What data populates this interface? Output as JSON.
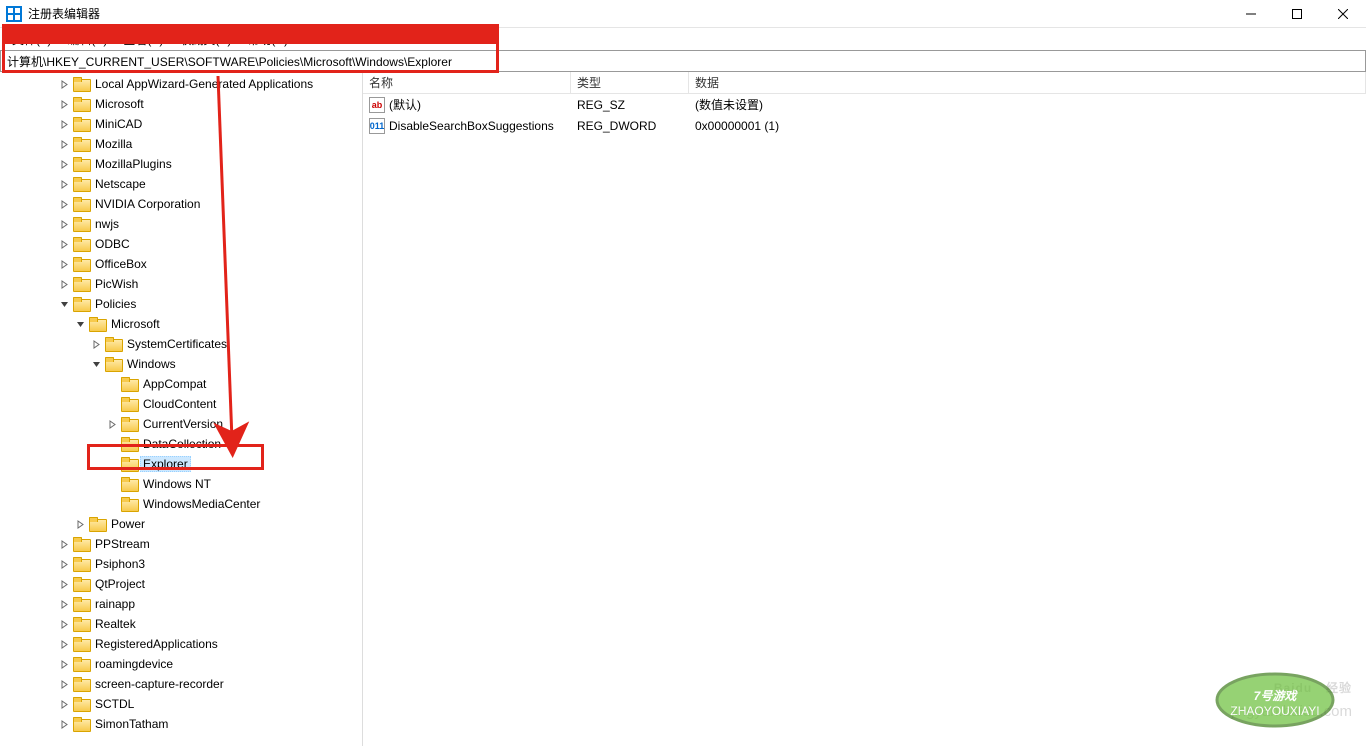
{
  "window": {
    "title": "注册表编辑器"
  },
  "menu": {
    "file": "文件(F)",
    "edit": "编辑(E)",
    "view": "查看(V)",
    "favorites": "收藏夹(A)",
    "help": "帮助(H)"
  },
  "address": {
    "path": "计算机\\HKEY_CURRENT_USER\\SOFTWARE\\Policies\\Microsoft\\Windows\\Explorer"
  },
  "tree": {
    "nodes": [
      {
        "indent": 3,
        "exp": ">",
        "label": "Local AppWizard-Generated Applications"
      },
      {
        "indent": 3,
        "exp": ">",
        "label": "Microsoft"
      },
      {
        "indent": 3,
        "exp": ">",
        "label": "MiniCAD"
      },
      {
        "indent": 3,
        "exp": ">",
        "label": "Mozilla"
      },
      {
        "indent": 3,
        "exp": ">",
        "label": "MozillaPlugins"
      },
      {
        "indent": 3,
        "exp": ">",
        "label": "Netscape"
      },
      {
        "indent": 3,
        "exp": ">",
        "label": "NVIDIA Corporation"
      },
      {
        "indent": 3,
        "exp": ">",
        "label": "nwjs"
      },
      {
        "indent": 3,
        "exp": ">",
        "label": "ODBC"
      },
      {
        "indent": 3,
        "exp": ">",
        "label": "OfficeBox"
      },
      {
        "indent": 3,
        "exp": ">",
        "label": "PicWish"
      },
      {
        "indent": 3,
        "exp": "v",
        "label": "Policies"
      },
      {
        "indent": 4,
        "exp": "v",
        "label": "Microsoft"
      },
      {
        "indent": 5,
        "exp": ">",
        "label": "SystemCertificates"
      },
      {
        "indent": 5,
        "exp": "v",
        "label": "Windows"
      },
      {
        "indent": 6,
        "exp": "",
        "label": "AppCompat"
      },
      {
        "indent": 6,
        "exp": "",
        "label": "CloudContent"
      },
      {
        "indent": 6,
        "exp": ">",
        "label": "CurrentVersion"
      },
      {
        "indent": 6,
        "exp": "",
        "label": "DataCollection"
      },
      {
        "indent": 6,
        "exp": "",
        "label": "Explorer",
        "selected": true
      },
      {
        "indent": 6,
        "exp": "",
        "label": "Windows NT"
      },
      {
        "indent": 6,
        "exp": "",
        "label": "WindowsMediaCenter"
      },
      {
        "indent": 4,
        "exp": ">",
        "label": "Power"
      },
      {
        "indent": 3,
        "exp": ">",
        "label": "PPStream"
      },
      {
        "indent": 3,
        "exp": ">",
        "label": "Psiphon3"
      },
      {
        "indent": 3,
        "exp": ">",
        "label": "QtProject"
      },
      {
        "indent": 3,
        "exp": ">",
        "label": "rainapp"
      },
      {
        "indent": 3,
        "exp": ">",
        "label": "Realtek"
      },
      {
        "indent": 3,
        "exp": ">",
        "label": "RegisteredApplications"
      },
      {
        "indent": 3,
        "exp": ">",
        "label": "roamingdevice"
      },
      {
        "indent": 3,
        "exp": ">",
        "label": "screen-capture-recorder"
      },
      {
        "indent": 3,
        "exp": ">",
        "label": "SCTDL"
      },
      {
        "indent": 3,
        "exp": ">",
        "label": "SimonTatham"
      }
    ]
  },
  "details": {
    "columns": {
      "name": "名称",
      "type": "类型",
      "data": "数据"
    },
    "rows": [
      {
        "icon": "sz",
        "name": "(默认)",
        "type": "REG_SZ",
        "data": "(数值未设置)"
      },
      {
        "icon": "dw",
        "name": "DisableSearchBoxSuggestions",
        "type": "REG_DWORD",
        "data": "0x00000001 (1)"
      }
    ]
  },
  "watermark": {
    "brand": "Baidu",
    "sub": "经验",
    "url": "jingyan.baidu.com",
    "badge": "7号游戏",
    "badge_sub": "ZHAOYOUXIAYI"
  }
}
